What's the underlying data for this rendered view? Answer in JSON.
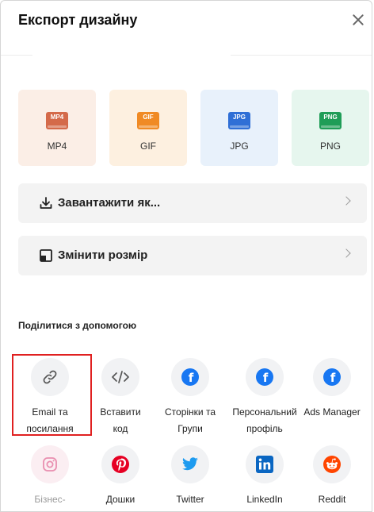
{
  "dialog": {
    "title": "Експорт дизайну"
  },
  "formats": [
    {
      "badge": "MP4",
      "label": "MP4",
      "bg": "#fbeee6",
      "badge_color": "#d46a4a"
    },
    {
      "badge": "GIF",
      "label": "GIF",
      "bg": "#fdf0e0",
      "badge_color": "#f08a24"
    },
    {
      "badge": "JPG",
      "label": "JPG",
      "bg": "#e8f1fb",
      "badge_color": "#2f6fd6"
    },
    {
      "badge": "PNG",
      "label": "PNG",
      "bg": "#e6f6ee",
      "badge_color": "#1f9d57"
    }
  ],
  "actions": {
    "download_label": "Завантажити як...",
    "resize_label": "Змінити розмір"
  },
  "share": {
    "section_title": "Поділитися з допомогою",
    "row1": [
      {
        "line1": "Email та",
        "line2": "посилання",
        "icon": "link-icon"
      },
      {
        "line1": "Вставити",
        "line2": "код",
        "icon": "code-icon"
      },
      {
        "line1": "Сторінки та",
        "line2": "Групи",
        "icon": "facebook-icon"
      },
      {
        "line1": "Персональний",
        "line2": "профіль",
        "icon": "facebook-icon"
      },
      {
        "line1": "Ads Manager",
        "line2": "",
        "icon": "facebook-icon"
      }
    ],
    "row2": [
      {
        "label": "Бізнес-",
        "icon": "instagram-icon"
      },
      {
        "label": "Дошки",
        "icon": "pinterest-icon"
      },
      {
        "label": "Twitter",
        "icon": "twitter-icon"
      },
      {
        "label": "LinkedIn",
        "icon": "linkedin-icon"
      },
      {
        "label": "Reddit",
        "icon": "reddit-icon"
      }
    ]
  },
  "colors": {
    "highlight": "#e02020",
    "facebook": "#1877f2",
    "pinterest": "#e60023",
    "twitter": "#1d9bf0",
    "linkedin": "#0a66c2",
    "reddit": "#ff4500"
  }
}
